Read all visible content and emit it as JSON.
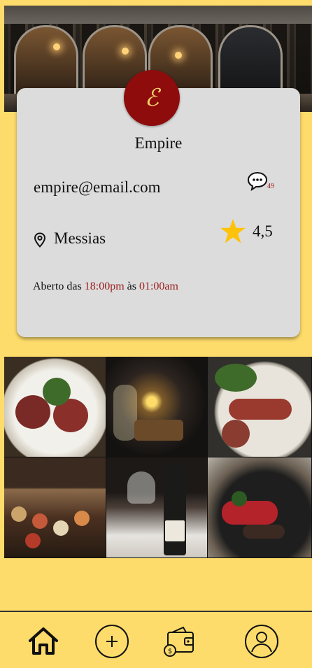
{
  "restaurant": {
    "logo_letter": "ℰ",
    "name": "Empire",
    "email": "empire@email.com",
    "message_count": "49",
    "location": "Messias",
    "rating": "4,5",
    "hours": {
      "prefix": "Aberto das ",
      "open": "18:00pm",
      "middle": " às ",
      "close": "01:00am"
    }
  },
  "colors": {
    "background": "#fedc6b",
    "card": "#dcdcdc",
    "logo_bg": "#8e0c0c",
    "accent_red": "#9b1c1c",
    "star": "#fec20a"
  },
  "icons": {
    "message": "message-bubble-icon",
    "location": "location-pin-icon",
    "rating": "star-icon"
  },
  "gallery": [
    {
      "name": "lamb-rack-photo"
    },
    {
      "name": "flambe-dessert-photo"
    },
    {
      "name": "octopus-salad-photo"
    },
    {
      "name": "sushi-platter-photo"
    },
    {
      "name": "wine-bottle-photo"
    },
    {
      "name": "chocolate-dessert-photo"
    }
  ],
  "nav": {
    "items": [
      "home-icon",
      "add-icon",
      "wallet-icon",
      "profile-icon"
    ]
  }
}
